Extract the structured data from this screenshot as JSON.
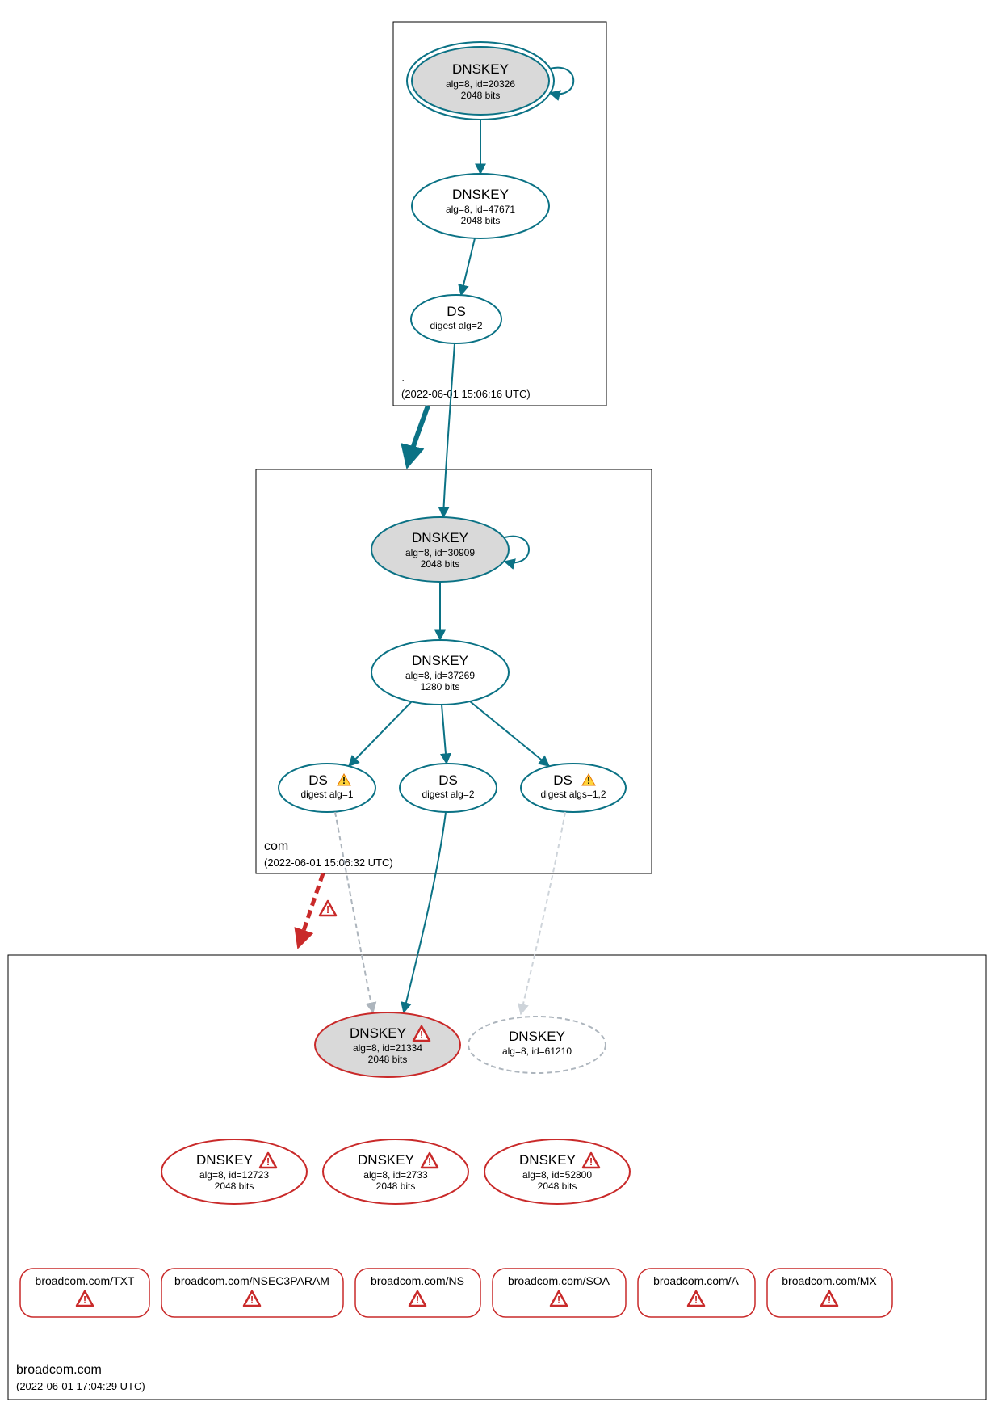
{
  "zones": {
    "root": {
      "name": ".",
      "timestamp": "(2022-06-01 15:06:16 UTC)"
    },
    "com": {
      "name": "com",
      "timestamp": "(2022-06-01 15:06:32 UTC)"
    },
    "broadcom": {
      "name": "broadcom.com",
      "timestamp": "(2022-06-01 17:04:29 UTC)"
    }
  },
  "root": {
    "ksk": {
      "title": "DNSKEY",
      "sub1": "alg=8, id=20326",
      "sub2": "2048 bits"
    },
    "zsk": {
      "title": "DNSKEY",
      "sub1": "alg=8, id=47671",
      "sub2": "2048 bits"
    },
    "ds": {
      "title": "DS",
      "sub1": "digest alg=2"
    }
  },
  "com": {
    "ksk": {
      "title": "DNSKEY",
      "sub1": "alg=8, id=30909",
      "sub2": "2048 bits"
    },
    "zsk": {
      "title": "DNSKEY",
      "sub1": "alg=8, id=37269",
      "sub2": "1280 bits"
    },
    "ds1": {
      "title": "DS",
      "sub1": "digest alg=1"
    },
    "ds2": {
      "title": "DS",
      "sub1": "digest alg=2"
    },
    "ds3": {
      "title": "DS",
      "sub1": "digest algs=1,2"
    }
  },
  "broadcom": {
    "key1": {
      "title": "DNSKEY",
      "sub1": "alg=8, id=21334",
      "sub2": "2048 bits"
    },
    "key2": {
      "title": "DNSKEY",
      "sub1": "alg=8, id=61210"
    },
    "k_a": {
      "title": "DNSKEY",
      "sub1": "alg=8, id=12723",
      "sub2": "2048 bits"
    },
    "k_b": {
      "title": "DNSKEY",
      "sub1": "alg=8, id=2733",
      "sub2": "2048 bits"
    },
    "k_c": {
      "title": "DNSKEY",
      "sub1": "alg=8, id=52800",
      "sub2": "2048 bits"
    }
  },
  "records": {
    "txt": "broadcom.com/TXT",
    "nsec3": "broadcom.com/NSEC3PARAM",
    "ns": "broadcom.com/NS",
    "soa": "broadcom.com/SOA",
    "a": "broadcom.com/A",
    "mx": "broadcom.com/MX"
  }
}
